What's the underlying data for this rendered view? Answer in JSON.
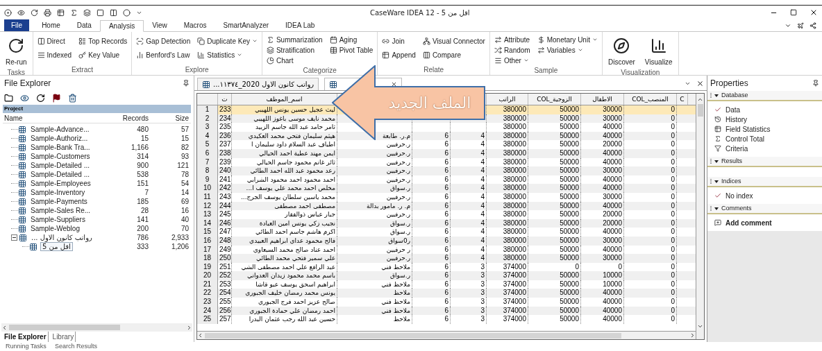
{
  "window": {
    "title": "CaseWare IDEA 12 - اقل من 5"
  },
  "ribbon_tabs": [
    {
      "label": "File",
      "selected": false,
      "kind": "file"
    },
    {
      "label": "Home",
      "selected": false,
      "kind": "tab"
    },
    {
      "label": "Data",
      "selected": false,
      "kind": "tab"
    },
    {
      "label": "Analysis",
      "selected": true,
      "kind": "tab"
    },
    {
      "label": "View",
      "selected": false,
      "kind": "tab"
    },
    {
      "label": "Macros",
      "selected": false,
      "kind": "tab"
    },
    {
      "label": "SmartAnalyzer",
      "selected": false,
      "kind": "tab"
    },
    {
      "label": "IDEA Lab",
      "selected": false,
      "kind": "tab"
    }
  ],
  "ribbon_groups": [
    {
      "label": "Tasks",
      "kind": "large",
      "columns": [
        [
          {
            "label": "Re-run",
            "dropdown": false
          }
        ]
      ]
    },
    {
      "label": "Extract",
      "kind": "small",
      "columns": [
        [
          {
            "label": "Direct",
            "dropdown": false
          },
          {
            "label": "Indexed",
            "dropdown": false
          }
        ],
        [
          {
            "label": "Top Records",
            "dropdown": false
          },
          {
            "label": "Key Value",
            "dropdown": false
          }
        ]
      ]
    },
    {
      "label": "Explore",
      "kind": "small",
      "columns": [
        [
          {
            "label": "Gap Detection",
            "dropdown": false
          },
          {
            "label": "Benford's Law",
            "dropdown": false
          }
        ],
        [
          {
            "label": "Duplicate Key",
            "dropdown": true
          },
          {
            "label": "Statistics",
            "dropdown": true
          }
        ]
      ]
    },
    {
      "label": "Categorize",
      "kind": "compact",
      "columns": [
        [
          {
            "label": "Summarization",
            "dropdown": false
          },
          {
            "label": "Stratification",
            "dropdown": false
          },
          {
            "label": "Chart",
            "dropdown": false
          }
        ],
        [
          {
            "label": "Aging",
            "dropdown": false
          },
          {
            "label": "Pivot Table",
            "dropdown": false
          }
        ]
      ]
    },
    {
      "label": "Relate",
      "kind": "small",
      "columns": [
        [
          {
            "label": "Join",
            "dropdown": false
          },
          {
            "label": "Append",
            "dropdown": false
          }
        ],
        [
          {
            "label": "Visual Connector",
            "dropdown": false
          },
          {
            "label": "Compare",
            "dropdown": false
          }
        ]
      ]
    },
    {
      "label": "Sample",
      "kind": "compact",
      "columns": [
        [
          {
            "label": "Attribute",
            "dropdown": false
          },
          {
            "label": "Random",
            "dropdown": false
          },
          {
            "label": "Other",
            "dropdown": true
          }
        ],
        [
          {
            "label": "Monetary Unit",
            "dropdown": true
          },
          {
            "label": "Variables",
            "dropdown": true
          }
        ]
      ]
    },
    {
      "label": "Visualization",
      "kind": "large",
      "columns": [
        [
          {
            "label": "Discover",
            "dropdown": false
          }
        ],
        [
          {
            "label": "Visualize",
            "dropdown": false
          }
        ]
      ]
    }
  ],
  "file_explorer": {
    "title": "File Explorer",
    "project": "Project",
    "columns": [
      "Name",
      "Records",
      "Size"
    ],
    "items": [
      {
        "name": "Sample-Advance...",
        "records": "480",
        "size": "57",
        "selected": false
      },
      {
        "name": "Sample-Authoriz...",
        "records": "15",
        "size": "15",
        "selected": false
      },
      {
        "name": "Sample-Bank Tra...",
        "records": "1,166",
        "size": "82",
        "selected": false
      },
      {
        "name": "Sample-Customers",
        "records": "314",
        "size": "93",
        "selected": false
      },
      {
        "name": "Sample-Detailed ...",
        "records": "900",
        "size": "121",
        "selected": false
      },
      {
        "name": "Sample-Detailed ...",
        "records": "538",
        "size": "78",
        "selected": false
      },
      {
        "name": "Sample-Employees",
        "records": "151",
        "size": "54",
        "selected": false
      },
      {
        "name": "Sample-Inventory",
        "records": "7",
        "size": "14",
        "selected": false
      },
      {
        "name": "Sample-Payments",
        "records": "185",
        "size": "69",
        "selected": false
      },
      {
        "name": "Sample-Sales Re...",
        "records": "28",
        "size": "16",
        "selected": false
      },
      {
        "name": "Sample-Suppliers",
        "records": "141",
        "size": "40",
        "selected": false
      },
      {
        "name": "Sample-Weblog",
        "records": "200",
        "size": "70",
        "selected": false
      },
      {
        "name": "... رواتب كانون الاول",
        "records": "786",
        "size": "2,933",
        "selected": false,
        "expanded": true,
        "children": [
          {
            "name": "اقل من 5",
            "records": "333",
            "size": "1,206",
            "selected": true
          }
        ]
      }
    ],
    "bottom_tabs": [
      {
        "label": "File Explorer",
        "selected": true
      },
      {
        "label": "Library",
        "selected": false
      }
    ]
  },
  "bottom_panels": [
    "Running Tasks",
    "Search Results"
  ],
  "document_tabs": [
    {
      "label": "...رواتب كانون الاول 2020_١١٣٧٤",
      "selected": false
    },
    {
      "selected": true
    }
  ],
  "table": {
    "columns": [
      "ت",
      "اسم_الموظف",
      null,
      null,
      null,
      "الراتب",
      "COL_الزوجية",
      "الاطفال",
      "COL_المنصب",
      "C"
    ],
    "rows": [
      {
        "n": "1",
        "selected": true,
        "cells": [
          "233",
          "ليث عجيل حسين يونس اللهيبي",
          null,
          null,
          null,
          "380000",
          "50000",
          "30000",
          "0"
        ]
      },
      {
        "n": "2",
        "selected": false,
        "cells": [
          "234",
          "محمد نايف موسى باغوز اللهيبي",
          null,
          null,
          null,
          "380000",
          "50000",
          "30000",
          "0"
        ]
      },
      {
        "n": "3",
        "selected": false,
        "cells": [
          "235",
          "ثامر حامد عبد الله جاسم الزبيد",
          null,
          null,
          null,
          "380000",
          "50000",
          "40000",
          "0"
        ]
      },
      {
        "n": "4",
        "selected": false,
        "cells": [
          "236",
          "هيثم سليمان فتحي محمد العكيدي",
          "م.ر. طابعة",
          "6",
          "4",
          "380000",
          "50000",
          "40000",
          "0"
        ]
      },
      {
        "n": "5",
        "selected": false,
        "cells": [
          "237",
          "اطياف عبد السلام داود سليمان ا",
          "ر.حرفيين",
          "6",
          "4",
          "380000",
          "50000",
          "20000",
          "0"
        ]
      },
      {
        "n": "6",
        "selected": false,
        "cells": [
          "238",
          "ايمن مهند عطية احمد الحيالي",
          "ر.حرفيين",
          "6",
          "4",
          "380000",
          "50000",
          "40000",
          "0"
        ]
      },
      {
        "n": "7",
        "selected": false,
        "cells": [
          "239",
          "ثائر غانم محمود جاسم الحيالي",
          "ر.حرفيين",
          "6",
          "4",
          "380000",
          "50000",
          "40000",
          "0"
        ]
      },
      {
        "n": "8",
        "selected": false,
        "cells": [
          "240",
          "رعد محمود عبد الله احمد الطائي",
          "ر.حرفيين",
          "6",
          "4",
          "380000",
          "50000",
          "30000",
          "0"
        ]
      },
      {
        "n": "9",
        "selected": false,
        "cells": [
          "241",
          "احمد محمود احمد محمود الشرابي",
          "ر.حرفيين",
          "6",
          "4",
          "380000",
          "50000",
          "40000",
          "0"
        ]
      },
      {
        "n": "10",
        "selected": false,
        "cells": [
          "242",
          "...مخلص احمد محمد علي يوسف ا",
          "ر.سواق",
          "6",
          "4",
          "380000",
          "50000",
          "40000",
          "0"
        ]
      },
      {
        "n": "11",
        "selected": false,
        "cells": [
          "243",
          "...محمد ياسين سلطان يوسف الجرج",
          "ر.حرفيين",
          "6",
          "4",
          "380000",
          "50000",
          "30000",
          "0"
        ]
      },
      {
        "n": "12",
        "selected": false,
        "cells": [
          "244",
          "مصطفى احمد مصطفى",
          "م. ر. مامور بدالة",
          "6",
          "4",
          "380000",
          "50000",
          "40000",
          "0"
        ]
      },
      {
        "n": "13",
        "selected": false,
        "cells": [
          "245",
          "جبار عباس ذوالفقار",
          "ر.حرفيين",
          "6",
          "4",
          "380000",
          "50000",
          "20000",
          "0"
        ]
      },
      {
        "n": "14",
        "selected": false,
        "cells": [
          "246",
          "نجيب زكي يونس امين العبادة",
          "ر.سواق",
          "6",
          "4",
          "380000",
          "50000",
          "20000",
          "0"
        ]
      },
      {
        "n": "15",
        "selected": false,
        "cells": [
          "247",
          "اكرم هاشم جاسم احمد الطائي",
          "ر.سواق",
          "6",
          "4",
          "380000",
          "50000",
          "40000",
          "0"
        ]
      },
      {
        "n": "16",
        "selected": false,
        "cells": [
          "248",
          "فالح محمود عداي ابراهيم العبيدي",
          "ر0سواق",
          "6",
          "4",
          "380000",
          "50000",
          "30000",
          "0"
        ]
      },
      {
        "n": "17",
        "selected": false,
        "cells": [
          "249",
          "احمد عناد صالح محمد السبعاوي",
          "ر حرفيين",
          "6",
          "4",
          "380000",
          "50000",
          "40000",
          "0"
        ]
      },
      {
        "n": "18",
        "selected": false,
        "cells": [
          "250",
          "علي سمير فتحي محمد الطائي",
          "ر.حرفيين",
          "6",
          "4",
          "380000",
          "50000",
          "30000",
          "0"
        ]
      },
      {
        "n": "19",
        "selected": false,
        "cells": [
          "251",
          "عبد الرافع علي احمد مصطفى الشي",
          "ملاحظ فني",
          "6",
          "3",
          "374000",
          "0",
          "0",
          "0"
        ]
      },
      {
        "n": "20",
        "selected": false,
        "cells": [
          "252",
          "باسم محمد محمود زيدان العدواني",
          "ر.سواق",
          "6",
          "3",
          "374000",
          "50000",
          "10000",
          "0"
        ]
      },
      {
        "n": "21",
        "selected": false,
        "cells": [
          "253",
          "ابراهيم اسحق يوسف عبو قاشا",
          "ملاحظ فني",
          "6",
          "3",
          "374000",
          "50000",
          "10000",
          "0"
        ]
      },
      {
        "n": "22",
        "selected": false,
        "cells": [
          "254",
          "يونس محمد رمضان خليف الجبوري",
          "ملاحظ",
          "6",
          "3",
          "374000",
          "50000",
          "40000",
          "0"
        ]
      },
      {
        "n": "23",
        "selected": false,
        "cells": [
          "255",
          "صالح عزيز احمد فرج الجبوري",
          "ملاحظ فني",
          "6",
          "3",
          "374000",
          "50000",
          "40000",
          "0"
        ]
      },
      {
        "n": "24",
        "selected": false,
        "cells": [
          "256",
          "احمد رمضان علي حمادة الجبوري",
          "ملاحظ فني",
          "6",
          "3",
          "374000",
          "50000",
          "40000",
          "0"
        ]
      },
      {
        "n": "25",
        "selected": false,
        "cells": [
          "257",
          "حسين عبد الله رجب عثمان البدرا",
          "ملاحظ",
          "6",
          "3",
          "374000",
          "50000",
          "40000",
          "0"
        ]
      }
    ]
  },
  "callout": {
    "text": "الملف الجديد"
  },
  "properties": {
    "title": "Properties",
    "sections": [
      {
        "label": "Database",
        "expanded": true,
        "items": [
          {
            "label": "Data",
            "kind": "link"
          },
          {
            "label": "History",
            "kind": "link"
          },
          {
            "label": "Field Statistics",
            "kind": "link"
          },
          {
            "label": "Control Total",
            "kind": "link"
          },
          {
            "label": "Criteria",
            "kind": "link"
          }
        ]
      },
      {
        "label": "Results",
        "expanded": true
      },
      {
        "label": "Indices",
        "expanded": true,
        "items": [
          {
            "label": "No index",
            "kind": "link"
          }
        ]
      },
      {
        "label": "Comments",
        "expanded": true,
        "items": [
          {
            "label": "Add comment",
            "kind": "action"
          }
        ]
      }
    ]
  }
}
